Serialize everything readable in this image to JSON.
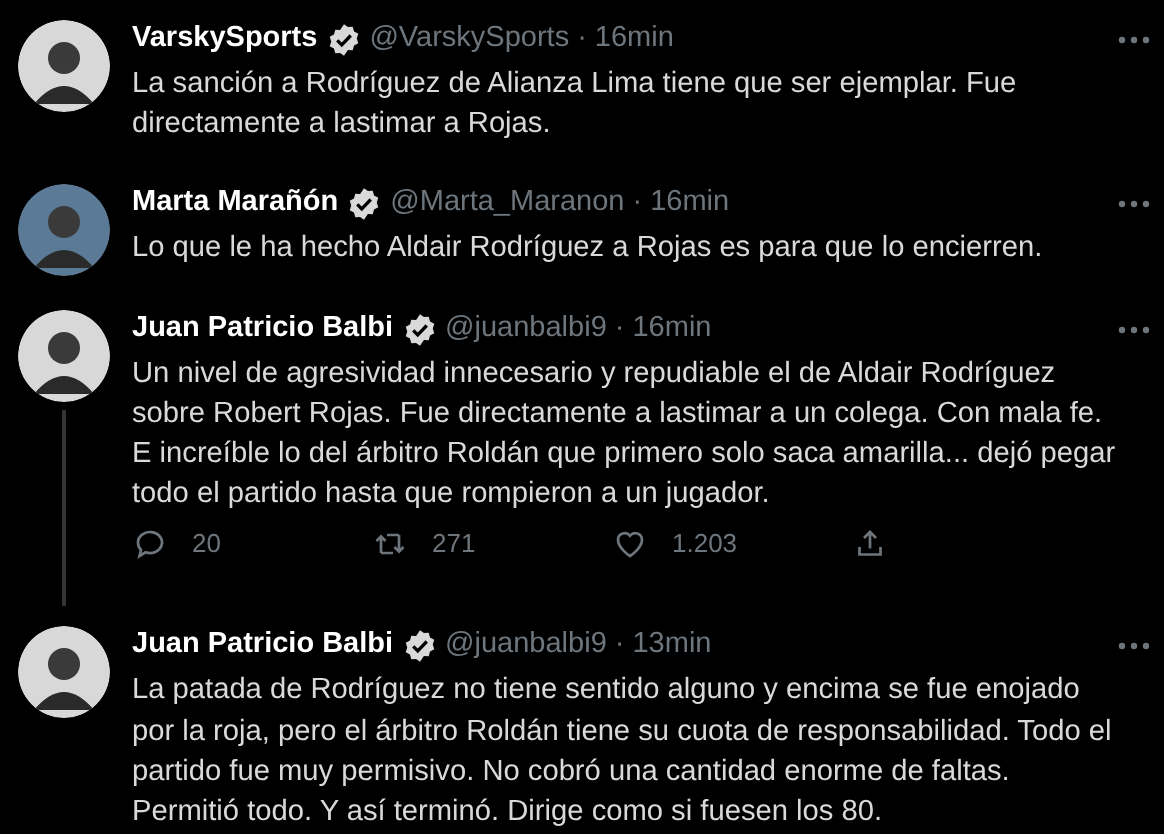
{
  "tweets": [
    {
      "name": "VarskySports",
      "verified": true,
      "handle": "@VarskySports",
      "separator": "·",
      "time": "16min",
      "text": "La sanción a Rodríguez de Alianza Lima tiene que ser ejemplar. Fue\ndirectamente a lastimar a Rojas.",
      "thread_below": false
    },
    {
      "name": "Marta Marañón",
      "verified": true,
      "handle": "@Marta_Maranon",
      "separator": "·",
      "time": "16min",
      "text": "Lo que le ha hecho Aldair Rodríguez a Rojas es para que lo encierren.",
      "thread_below": false
    },
    {
      "name": "Juan Patricio Balbi",
      "verified": true,
      "handle": "@juanbalbi9",
      "separator": "·",
      "time": "16min",
      "text": "Un nivel de agresividad innecesario y repudiable el de Aldair Rodríguez\nsobre Robert Rojas. Fue directamente a lastimar a un colega. Con mala fe.\nE increíble lo del árbitro Roldán que primero solo saca amarilla... dejó pegar\ntodo el partido hasta que rompieron a un jugador.",
      "thread_below": true,
      "actions": {
        "replies": "20",
        "retweets": "271",
        "likes": "1.203"
      }
    },
    {
      "name": "Juan Patricio Balbi",
      "verified": true,
      "handle": "@juanbalbi9",
      "separator": "·",
      "time": "13min",
      "text": "La patada de Rodríguez no tiene sentido alguno y encima se fue enojado\npor la roja, pero el árbitro Roldán tiene su cuota de responsabilidad. Todo el\npartido fue muy permisivo. No cobró una cantidad enorme de faltas.\nPermitió todo. Y así terminó. Dirige como si fuesen los 80.",
      "thread_below": false
    }
  ]
}
